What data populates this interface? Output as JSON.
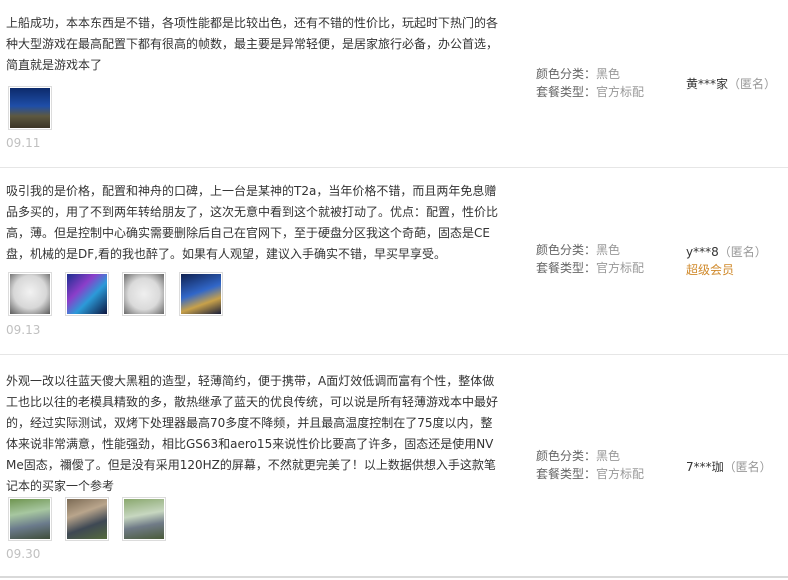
{
  "labels": {
    "color_key": "颜色分类：",
    "package_key": "套餐类型："
  },
  "reviews": [
    {
      "content": "上船成功，本本东西是不错，各项性能都是比较出色，还有不错的性价比，玩起时下热门的各种大型游戏在最高配置下都有很高的帧数，最主要是异常轻便，是居家旅行必备，办公首选，简直就是游戏本了",
      "date": "09.11",
      "color": "黑色",
      "package": "官方标配",
      "user": "黄***家",
      "anon": "（匿名）",
      "badge": "",
      "images": [
        "screen-dark"
      ]
    },
    {
      "content": "吸引我的是价格，配置和神舟的口碑，上一台是某神的T2a，当年价格不错，而且两年免息赠品多买的，用了不到两年转给朋友了，这次无意中看到这个就被打动了。优点：配置，性价比高，薄。但是控制中心确实需要删除后自己在官网下，至于硬盘分区我这个奇葩，固态是CE盘，机械的是DF,看的我也醉了。如果有人观望，建议入手确实不错，早买早享受。",
      "date": "09.13",
      "color": "黑色",
      "package": "官方标配",
      "user": "y***8",
      "anon": "（匿名）",
      "badge": "超级会员",
      "images": [
        "laptop-white",
        "screen-blue",
        "laptop-white",
        "screen-blue"
      ]
    },
    {
      "content": "外观一改以往蓝天傻大黑粗的造型，轻薄简约，便于携带，A面灯效低调而富有个性，整体做工也比以往的老模具精致的多，散热继承了蓝天的优良传统，可以说是所有轻薄游戏本中最好的，经过实际测试，双烤下处理器最高70多度不降频，并且最高温度控制在了75度以内，整体来说非常满意，性能强劲，相比GS63和aero15来说性价比要高了许多，固态还是使用NVMe固态，禰僾了。但是没有采用120HZ的屏幕，不然就更完美了！以上数据供想入手这款笔记本的买家一个参考",
      "date": "09.30",
      "color": "黑色",
      "package": "官方标配",
      "user": "7***珈",
      "anon": "（匿名）",
      "badge": "",
      "images": [
        "outdoor",
        "outdoor",
        "outdoor"
      ]
    }
  ]
}
